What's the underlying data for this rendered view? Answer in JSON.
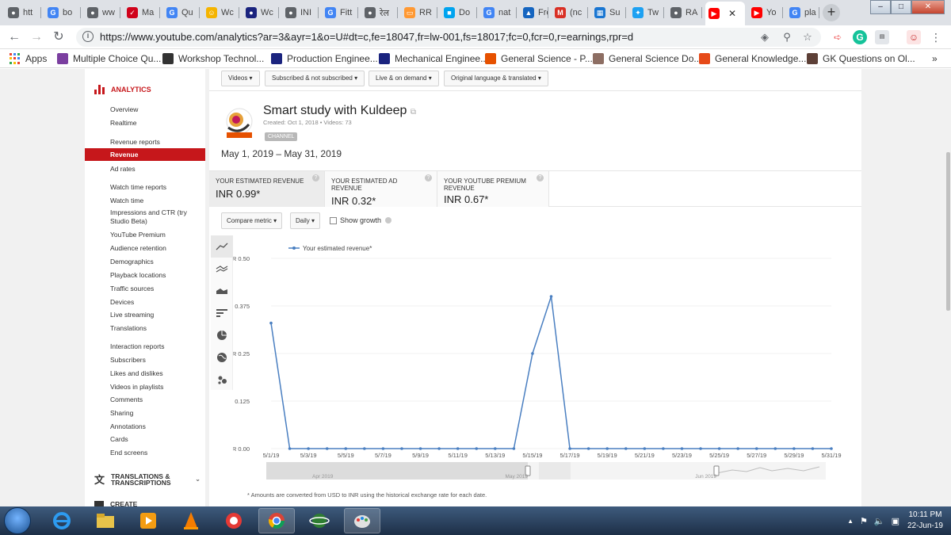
{
  "browser": {
    "tabs": [
      {
        "label": "htt",
        "icon": "globe-icon",
        "color": "#5f6368"
      },
      {
        "label": "bo",
        "icon": "google-icon",
        "color": "#4285f4"
      },
      {
        "label": "ww",
        "icon": "globe-icon",
        "color": "#5f6368"
      },
      {
        "label": "Ma",
        "icon": "check-icon",
        "color": "#d0021b"
      },
      {
        "label": "Qu",
        "icon": "google-icon",
        "color": "#4285f4"
      },
      {
        "label": "Wc",
        "icon": "emoji-icon",
        "color": "#f5b400"
      },
      {
        "label": "Wc",
        "icon": "globe-icon",
        "color": "#1a237e"
      },
      {
        "label": "INI",
        "icon": "globe-icon",
        "color": "#5f6368"
      },
      {
        "label": "Fitt",
        "icon": "google-icon",
        "color": "#4285f4"
      },
      {
        "label": "रेल",
        "icon": "globe-icon",
        "color": "#5f6368"
      },
      {
        "label": "RR",
        "icon": "flag-icon",
        "color": "#ff9933"
      },
      {
        "label": "Do",
        "icon": "windows-icon",
        "color": "#00a4ef"
      },
      {
        "label": "nat",
        "icon": "google-icon",
        "color": "#4285f4"
      },
      {
        "label": "Fre",
        "icon": "bookmark-icon",
        "color": "#1565c0"
      },
      {
        "label": "(nc",
        "icon": "gmail-icon",
        "color": "#d93025"
      },
      {
        "label": "Su",
        "icon": "grid-icon",
        "color": "#1976d2"
      },
      {
        "label": "Tw",
        "icon": "twitter-icon",
        "color": "#1da1f2"
      },
      {
        "label": "RA",
        "icon": "globe-icon",
        "color": "#5f6368"
      },
      {
        "label": "",
        "icon": "youtube-icon",
        "color": "#ff0000",
        "active": true
      },
      {
        "label": "Yo",
        "icon": "youtube-icon",
        "color": "#ff0000"
      },
      {
        "label": "pla",
        "icon": "google-icon",
        "color": "#4285f4"
      }
    ],
    "url": "https://www.youtube.com/analytics?ar=3&ayr=1&o=U#dt=c,fe=18047,fr=lw-001,fs=18017;fc=0,fcr=0,r=earnings,rpr=d",
    "bookmarks": [
      {
        "label": "Apps",
        "color": "#4285f4"
      },
      {
        "label": "Multiple Choice Qu...",
        "color": "#7b3fa0"
      },
      {
        "label": "Workshop Technol...",
        "color": "#333333"
      },
      {
        "label": "Production Enginee...",
        "color": "#1a237e"
      },
      {
        "label": "Mechanical Enginee...",
        "color": "#1a237e"
      },
      {
        "label": "General Science - P...",
        "color": "#e65100"
      },
      {
        "label": "General Science Do...",
        "color": "#8d6e63"
      },
      {
        "label": "General Knowledge...",
        "color": "#e64a19"
      },
      {
        "label": "GK Questions on Ol...",
        "color": "#5d4037"
      }
    ],
    "more": "»"
  },
  "sidebar": {
    "heading": "ANALYTICS",
    "items": [
      {
        "label": "Overview"
      },
      {
        "label": "Realtime"
      },
      {
        "label": "Revenue reports"
      },
      {
        "label": "Revenue",
        "selected": true
      },
      {
        "label": "Ad rates"
      },
      {
        "label": "Watch time reports"
      },
      {
        "label": "Watch time"
      },
      {
        "label": "Impressions and CTR (try Studio Beta)"
      },
      {
        "label": "YouTube Premium"
      },
      {
        "label": "Audience retention"
      },
      {
        "label": "Demographics"
      },
      {
        "label": "Playback locations"
      },
      {
        "label": "Traffic sources"
      },
      {
        "label": "Devices"
      },
      {
        "label": "Live streaming"
      },
      {
        "label": "Translations"
      },
      {
        "label": "Interaction reports"
      },
      {
        "label": "Subscribers"
      },
      {
        "label": "Likes and dislikes"
      },
      {
        "label": "Videos in playlists"
      },
      {
        "label": "Comments"
      },
      {
        "label": "Sharing"
      },
      {
        "label": "Annotations"
      },
      {
        "label": "Cards"
      },
      {
        "label": "End screens"
      }
    ],
    "translations": "TRANSLATIONS & TRANSCRIPTIONS",
    "create": "CREATE"
  },
  "filters": [
    "Videos",
    "Subscribed & not subscribed",
    "Live & on demand",
    "Original language & translated"
  ],
  "channel": {
    "name": "Smart study with Kuldeep",
    "meta": "Created: Oct 1, 2018  •  Videos: 73",
    "badge": "CHANNEL",
    "logo_text": "SMART STUDY"
  },
  "date_range": "May 1, 2019 – May 31, 2019",
  "metrics": [
    {
      "label": "YOUR ESTIMATED REVENUE",
      "value": "INR 0.99*"
    },
    {
      "label": "YOUR ESTIMATED AD REVENUE",
      "value": "INR 0.32*"
    },
    {
      "label": "YOUR YOUTUBE PREMIUM REVENUE",
      "value": "INR 0.67*"
    }
  ],
  "controls": {
    "compare": "Compare metric",
    "interval": "Daily",
    "growth": "Show growth"
  },
  "chart_data": {
    "type": "line",
    "series": [
      {
        "name": "Your estimated revenue*",
        "color": "#4a7fc1",
        "values": [
          0.33,
          0,
          0,
          0,
          0,
          0,
          0,
          0,
          0,
          0,
          0,
          0,
          0,
          0,
          0.25,
          0.4,
          0,
          0,
          0,
          0,
          0,
          0,
          0,
          0,
          0,
          0,
          0,
          0,
          0,
          0,
          0
        ]
      }
    ],
    "x": [
      "5/1/19",
      "5/2/19",
      "5/3/19",
      "5/4/19",
      "5/5/19",
      "5/6/19",
      "5/7/19",
      "5/8/19",
      "5/9/19",
      "5/10/19",
      "5/11/19",
      "5/12/19",
      "5/13/19",
      "5/14/19",
      "5/15/19",
      "5/16/19",
      "5/17/19",
      "5/18/19",
      "5/19/19",
      "5/20/19",
      "5/21/19",
      "5/22/19",
      "5/23/19",
      "5/24/19",
      "5/25/19",
      "5/26/19",
      "5/27/19",
      "5/28/19",
      "5/29/19",
      "5/30/19",
      "5/31/19"
    ],
    "xticks": [
      "5/1/19",
      "5/3/19",
      "5/5/19",
      "5/7/19",
      "5/9/19",
      "5/11/19",
      "5/13/19",
      "5/15/19",
      "5/17/19",
      "5/19/19",
      "5/21/19",
      "5/23/19",
      "5/25/19",
      "5/27/19",
      "5/29/19",
      "5/31/19"
    ],
    "yticks": [
      "INR 0.50",
      "INR 0.375",
      "INR 0.25",
      "INR 0.125",
      "INR 0.00"
    ],
    "ylim": [
      0,
      0.5
    ],
    "legend": "top-left",
    "navigator_labels": [
      "Apr 2019",
      "May 2019",
      "Jun 2019"
    ]
  },
  "footnote": "* Amounts are converted from USD to INR using the historical exchange rate for each date.",
  "taskbar": {
    "time": "10:11 PM",
    "date": "22-Jun-19"
  }
}
